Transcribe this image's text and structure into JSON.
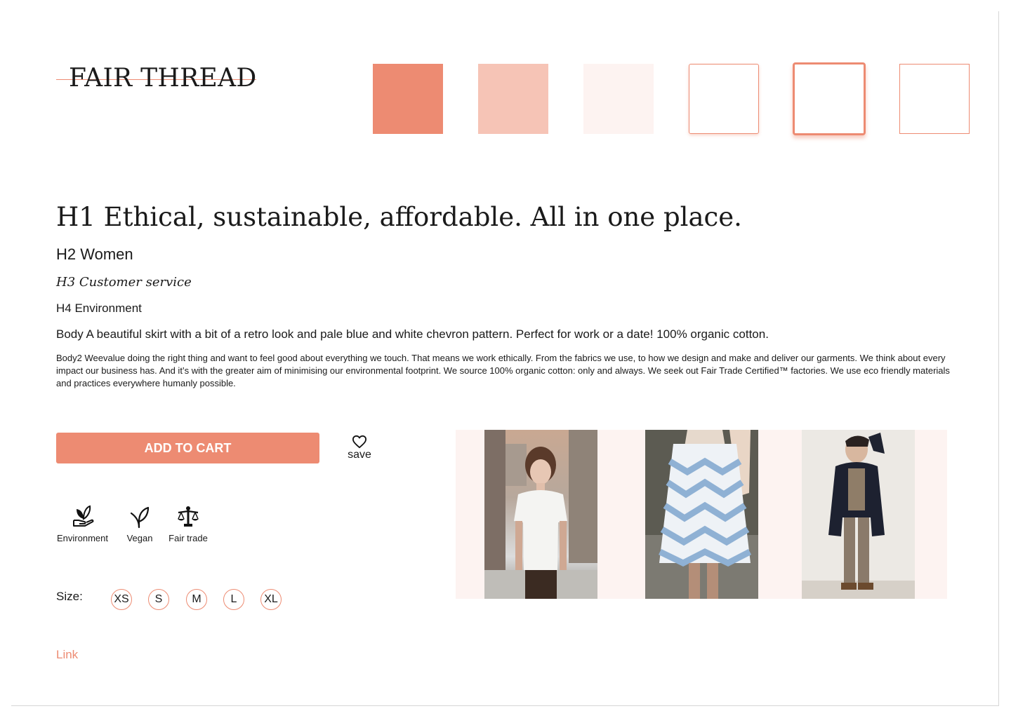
{
  "brand": {
    "name": "FAIR THREAD"
  },
  "palette": [
    "#ed8b72",
    "#f6c4b6",
    "#fdf3f1",
    "#ffffff"
  ],
  "typography": {
    "h1": "H1 Ethical, sustainable, affordable. All in one place.",
    "h2": "H2 Women",
    "h3": "H3 Customer service",
    "h4": "H4 Environment",
    "body": "Body A beautiful skirt with a bit of a retro look and pale blue and white chevron pattern. Perfect for work or a date! 100% organic cotton.",
    "body2": "Body2 Weevalue doing the right thing and want to feel good about everything we touch. That means we work ethically. From the fabrics we use, to how we design and make and deliver our garments. We think about every impact our business has. And it’s with the greater aim of minimising our environmental footprint. We source 100% organic cotton: only and always. We seek out Fair Trade Certified™ factories. We use eco friendly materials and practices everywhere humanly possible."
  },
  "actions": {
    "add_to_cart": "ADD TO CART",
    "save": "save"
  },
  "features": [
    {
      "icon": "hand-plant-icon",
      "label": "Environment"
    },
    {
      "icon": "leaf-icon",
      "label": "Vegan"
    },
    {
      "icon": "scales-icon",
      "label": "Fair trade"
    }
  ],
  "size": {
    "label": "Size:",
    "options": [
      "XS",
      "S",
      "M",
      "L",
      "XL"
    ]
  },
  "link": {
    "text": "Link"
  }
}
